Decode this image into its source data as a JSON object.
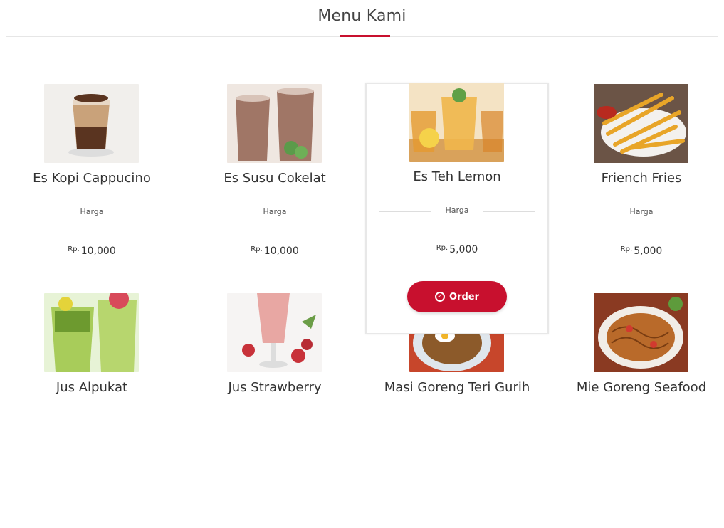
{
  "header": {
    "title": "Menu Kami"
  },
  "price_label": "Harga",
  "currency": "Rp.",
  "order_label": "Order",
  "colors": {
    "accent": "#c8102e"
  },
  "menu": [
    {
      "name": "Es Kopi Cappucino",
      "price": "10,000"
    },
    {
      "name": "Es Susu Cokelat",
      "price": "10,000"
    },
    {
      "name": "Es Teh Lemon",
      "price": "5,000"
    },
    {
      "name": "Friench Fries",
      "price": "5,000"
    },
    {
      "name": "Jus Alpukat"
    },
    {
      "name": "Jus Strawberry"
    },
    {
      "name": "Masi Goreng Teri Gurih"
    },
    {
      "name": "Mie Goreng Seafood"
    }
  ]
}
